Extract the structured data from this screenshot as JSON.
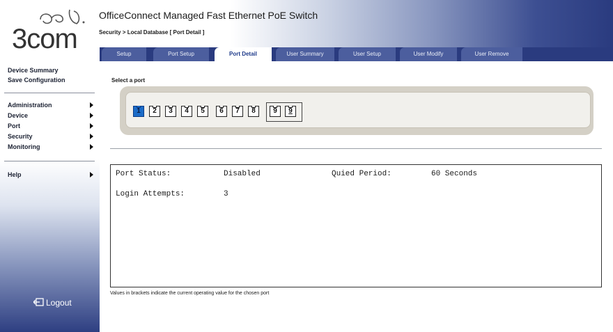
{
  "brand": {
    "logo_text": "3com"
  },
  "header": {
    "title": "OfficeConnect Managed Fast Ethernet PoE Switch",
    "breadcrumb": "Security > Local Database [ Port Detail ]"
  },
  "sidebar": {
    "top_links": [
      "Device Summary",
      "Save Configuration"
    ],
    "menu": [
      "Administration",
      "Device",
      "Port",
      "Security",
      "Monitoring"
    ],
    "help": "Help",
    "logout": "Logout"
  },
  "tabs": [
    {
      "label": "Setup",
      "active": false
    },
    {
      "label": "Port Setup",
      "active": false
    },
    {
      "label": "Port Detail",
      "active": true
    },
    {
      "label": "User Summary",
      "active": false
    },
    {
      "label": "User Setup",
      "active": false
    },
    {
      "label": "User Modify",
      "active": false
    },
    {
      "label": "User Remove",
      "active": false
    }
  ],
  "port_selector": {
    "label": "Select a port",
    "ports": [
      "1",
      "2",
      "3",
      "4",
      "5",
      "6",
      "7",
      "8",
      "9",
      "9"
    ],
    "selected": "1"
  },
  "details": {
    "port_status_label": "Port Status:",
    "port_status_value": "Disabled",
    "quiet_period_label": "Quied Period:",
    "quiet_period_value": "60 Seconds",
    "login_attempts_label": "Login Attempts:",
    "login_attempts_value": "3"
  },
  "footnote": "Values in brackets indicate the current operating value for the chosen port",
  "colors": {
    "accent": "#2a3b7f",
    "tab": "#4c5e9e",
    "selected_port": "#1c6cc8"
  }
}
